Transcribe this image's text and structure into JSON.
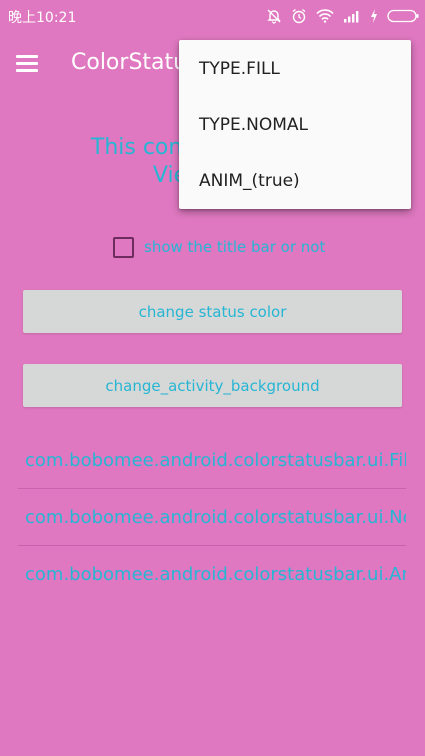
{
  "status_bar": {
    "time": "晚上10:21",
    "icons": [
      "mute-bell-icon",
      "alarm-icon",
      "wifi-icon",
      "signal-icon",
      "charging-icon",
      "battery-icon"
    ]
  },
  "toolbar": {
    "title": "ColorStatusBar",
    "menu_icon": "hamburger-menu-icon"
  },
  "main": {
    "description_line1": "This content is behind",
    "description_line2": "ViewGroup",
    "checkbox_label": "show the title bar or not",
    "checkbox_checked": false,
    "button_status_color": "change status color",
    "button_activity_background": "change_activity_background",
    "list_items": [
      "com.bobomee.android.colorstatusbar.ui.FillActivity",
      "com.bobomee.android.colorstatusbar.ui.NomalActivity",
      "com.bobomee.android.colorstatusbar.ui.AnimActivity"
    ]
  },
  "popup_menu": {
    "items": [
      "TYPE.FILL",
      "TYPE.NOMAL",
      "ANIM_(true)"
    ]
  },
  "colors": {
    "background": "#df78c0",
    "accent_text": "#26b6d4",
    "button_bg": "#d6d7d7",
    "menu_bg": "#fafafa"
  }
}
